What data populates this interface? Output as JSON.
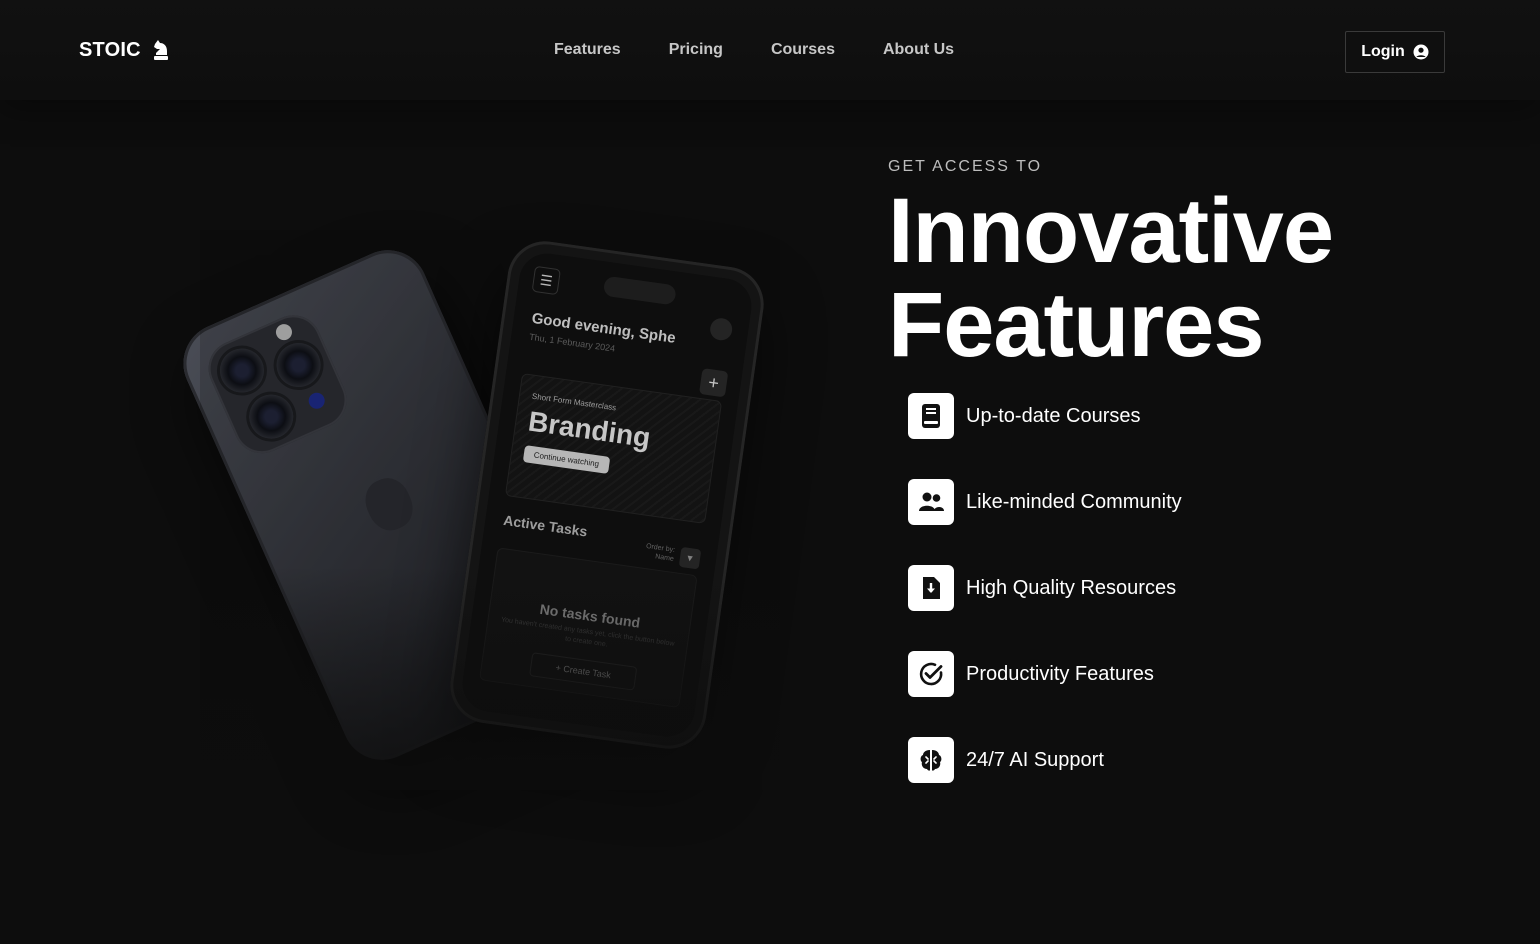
{
  "nav": {
    "brand": "STOIC",
    "brand_icon": "chess-knight-icon",
    "links": [
      "Features",
      "Pricing",
      "Courses",
      "About Us"
    ],
    "login_label": "Login",
    "login_icon": "user-circle-icon"
  },
  "phone_screen": {
    "greeting": "Good evening, Sphe",
    "date": "Thu, 1 February 2024",
    "course_kicker": "Short Form Masterclass",
    "course_title": "Branding",
    "continue_label": "Continue watching",
    "active_tasks": "Active Tasks",
    "order_by": "Order by:",
    "order_value": "Name",
    "no_tasks": "No tasks found",
    "no_tasks_sub": "You haven't created any tasks yet, click the button below to create one.",
    "create_task": "+ Create Task"
  },
  "hero": {
    "eyebrow": "GET ACCESS TO",
    "headline_line1": "Innovative",
    "headline_line2": "Features"
  },
  "features": [
    {
      "label": "Up-to-date Courses",
      "icon": "book-icon"
    },
    {
      "label": "Like-minded Community",
      "icon": "users-icon"
    },
    {
      "label": "High Quality Resources",
      "icon": "file-download-icon"
    },
    {
      "label": "Productivity Features",
      "icon": "check-circle-icon"
    },
    {
      "label": "24/7 AI Support",
      "icon": "brain-icon"
    }
  ],
  "colors": {
    "background": "#0d0d0d",
    "text": "#ffffff",
    "muted": "#c7c7c7",
    "icon_tile": "#ffffff"
  }
}
